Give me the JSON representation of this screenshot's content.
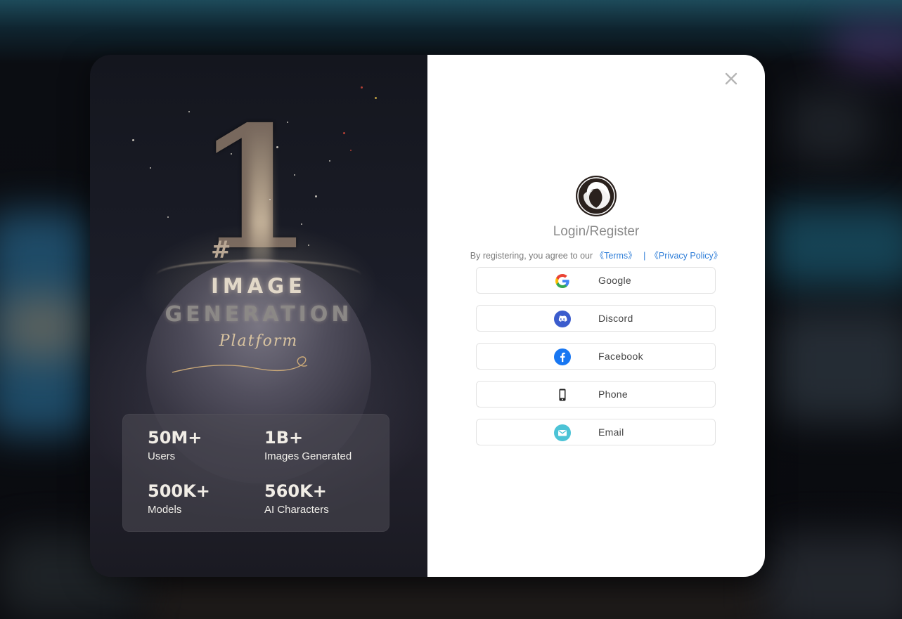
{
  "promo": {
    "hero": {
      "hash": "#",
      "number": "1",
      "line1": "IMAGE",
      "line2": "GENERATION",
      "line3": "Platform"
    },
    "stats": [
      {
        "value": "50M+",
        "label": "Users"
      },
      {
        "value": "1B+",
        "label": "Images Generated"
      },
      {
        "value": "500K+",
        "label": "Models"
      },
      {
        "value": "560K+",
        "label": "AI Characters"
      }
    ]
  },
  "auth": {
    "title": "Login/Register",
    "agreement": {
      "text": "By registering, you agree to our",
      "terms": "《Terms》",
      "separator": "|",
      "privacy": "《Privacy Policy》"
    },
    "providers": [
      {
        "label": "Google",
        "icon": "google-icon"
      },
      {
        "label": "Discord",
        "icon": "discord-icon"
      },
      {
        "label": "Facebook",
        "icon": "facebook-icon"
      },
      {
        "label": "Phone",
        "icon": "phone-icon"
      },
      {
        "label": "Email",
        "icon": "email-icon"
      }
    ]
  },
  "colors": {
    "link": "#2f7ed8",
    "facebook": "#1877f2",
    "discord": "#3b5ccd",
    "email": "#4cc3d6"
  }
}
